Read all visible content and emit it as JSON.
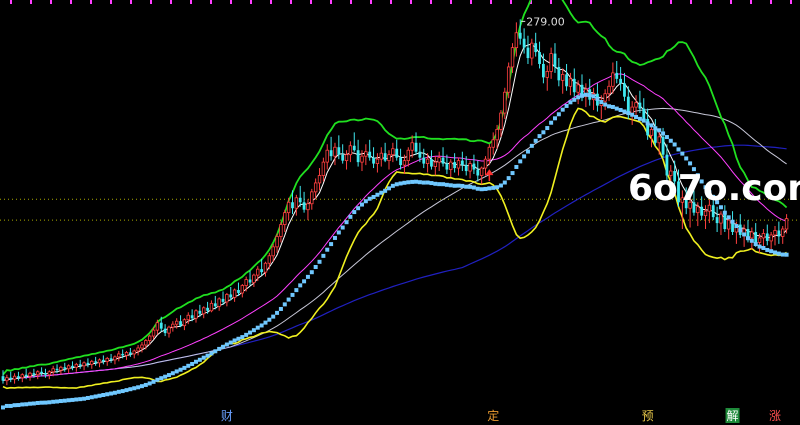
{
  "chart_data": {
    "type": "candlestick",
    "price_label": "279.00",
    "watermark": "6o7o.com",
    "event_markers": [
      {
        "label": "财",
        "bar": 58,
        "color": "#6aa0ff"
      },
      {
        "label": "定",
        "bar": 127,
        "color": "#e89a30"
      },
      {
        "label": "预",
        "bar": 167,
        "color": "#e8c84a"
      },
      {
        "label": "解",
        "bar": 189,
        "color": "#ffffff",
        "bg": "#1e8a3a"
      },
      {
        "label": "涨",
        "bar": 200,
        "color": "#ff5050"
      }
    ],
    "colors": {
      "up": "#ff4040",
      "down": "#40e8f0",
      "ma_white": "#ffffff",
      "ma_magenta": "#ff40ff",
      "ma_gray": "#c8c8d8",
      "ma_blue": "#2020c0",
      "dots": "#70c8ff",
      "band_upper": "#20e020",
      "band_lower": "#f0f020",
      "ref_line": "#a8a800",
      "top_ticks": "#ff40ff"
    },
    "x_index_range": [
      0,
      203
    ],
    "price_range": [
      25,
      290
    ],
    "reference_levels": [
      160,
      146
    ],
    "signal_arrow_bar": 126,
    "max_bar": 134,
    "candles": [
      [
        0,
        41,
        45,
        36,
        38
      ],
      [
        1,
        38,
        42,
        35,
        40
      ],
      [
        2,
        40,
        44,
        37,
        39
      ],
      [
        3,
        39,
        43,
        36,
        41
      ],
      [
        4,
        41,
        44,
        38,
        40
      ],
      [
        5,
        40,
        43,
        37,
        42
      ],
      [
        6,
        42,
        46,
        39,
        41
      ],
      [
        7,
        41,
        44,
        38,
        43
      ],
      [
        8,
        43,
        46,
        40,
        42
      ],
      [
        9,
        42,
        45,
        39,
        44
      ],
      [
        10,
        44,
        47,
        41,
        43
      ],
      [
        11,
        43,
        46,
        40,
        42
      ],
      [
        12,
        42,
        45,
        39,
        44
      ],
      [
        13,
        44,
        48,
        41,
        46
      ],
      [
        14,
        46,
        49,
        43,
        45
      ],
      [
        15,
        45,
        48,
        42,
        47
      ],
      [
        16,
        47,
        50,
        44,
        46
      ],
      [
        17,
        46,
        49,
        43,
        48
      ],
      [
        18,
        48,
        51,
        45,
        47
      ],
      [
        19,
        47,
        50,
        44,
        49
      ],
      [
        20,
        49,
        52,
        46,
        48
      ],
      [
        21,
        48,
        51,
        45,
        50
      ],
      [
        22,
        50,
        53,
        47,
        49
      ],
      [
        23,
        49,
        52,
        46,
        51
      ],
      [
        24,
        51,
        54,
        48,
        50
      ],
      [
        25,
        50,
        53,
        47,
        52
      ],
      [
        26,
        52,
        55,
        49,
        51
      ],
      [
        27,
        51,
        54,
        48,
        53
      ],
      [
        28,
        53,
        56,
        50,
        52
      ],
      [
        29,
        52,
        55,
        49,
        54
      ],
      [
        30,
        54,
        58,
        51,
        56
      ],
      [
        31,
        56,
        59,
        53,
        55
      ],
      [
        32,
        55,
        58,
        52,
        57
      ],
      [
        33,
        57,
        60,
        54,
        56
      ],
      [
        34,
        56,
        59,
        53,
        58
      ],
      [
        35,
        58,
        62,
        55,
        60
      ],
      [
        36,
        60,
        64,
        57,
        62
      ],
      [
        37,
        62,
        66,
        59,
        65
      ],
      [
        38,
        65,
        69,
        62,
        68
      ],
      [
        39,
        68,
        74,
        66,
        72
      ],
      [
        40,
        72,
        79,
        69,
        77
      ],
      [
        41,
        77,
        81,
        71,
        73
      ],
      [
        42,
        73,
        76,
        68,
        70
      ],
      [
        43,
        70,
        75,
        67,
        74
      ],
      [
        44,
        74,
        78,
        71,
        76
      ],
      [
        45,
        76,
        80,
        73,
        78
      ],
      [
        46,
        78,
        82,
        74,
        75
      ],
      [
        47,
        75,
        80,
        72,
        79
      ],
      [
        48,
        79,
        84,
        76,
        82
      ],
      [
        49,
        82,
        86,
        78,
        80
      ],
      [
        50,
        80,
        86,
        77,
        85
      ],
      [
        51,
        85,
        89,
        81,
        83
      ],
      [
        52,
        83,
        88,
        80,
        87
      ],
      [
        53,
        87,
        91,
        83,
        85
      ],
      [
        54,
        85,
        92,
        84,
        90
      ],
      [
        55,
        90,
        95,
        86,
        88
      ],
      [
        56,
        88,
        94,
        85,
        93
      ],
      [
        57,
        93,
        98,
        89,
        91
      ],
      [
        58,
        91,
        97,
        88,
        96
      ],
      [
        59,
        96,
        101,
        92,
        94
      ],
      [
        60,
        94,
        100,
        91,
        99
      ],
      [
        61,
        99,
        104,
        95,
        97
      ],
      [
        62,
        97,
        103,
        94,
        102
      ],
      [
        63,
        102,
        108,
        98,
        106
      ],
      [
        64,
        106,
        112,
        102,
        104
      ],
      [
        65,
        104,
        110,
        101,
        109
      ],
      [
        66,
        109,
        115,
        105,
        113
      ],
      [
        67,
        113,
        120,
        109,
        111
      ],
      [
        68,
        111,
        118,
        108,
        117
      ],
      [
        69,
        117,
        124,
        113,
        122
      ],
      [
        70,
        122,
        130,
        118,
        128
      ],
      [
        71,
        128,
        137,
        124,
        135
      ],
      [
        72,
        135,
        145,
        131,
        143
      ],
      [
        73,
        143,
        153,
        138,
        151
      ],
      [
        74,
        151,
        161,
        146,
        158
      ],
      [
        75,
        158,
        166,
        150,
        154
      ],
      [
        76,
        154,
        163,
        149,
        161
      ],
      [
        77,
        161,
        169,
        155,
        158
      ],
      [
        78,
        158,
        165,
        151,
        153
      ],
      [
        79,
        153,
        160,
        146,
        157
      ],
      [
        80,
        157,
        167,
        153,
        165
      ],
      [
        81,
        165,
        174,
        160,
        171
      ],
      [
        82,
        171,
        181,
        166,
        176
      ],
      [
        83,
        176,
        188,
        172,
        185
      ],
      [
        84,
        185,
        197,
        180,
        193
      ],
      [
        85,
        193,
        202,
        186,
        189
      ],
      [
        86,
        189,
        198,
        183,
        195
      ],
      [
        87,
        195,
        203,
        187,
        190
      ],
      [
        88,
        190,
        197,
        184,
        186
      ],
      [
        89,
        186,
        193,
        180,
        190
      ],
      [
        90,
        190,
        199,
        185,
        196
      ],
      [
        91,
        196,
        205,
        192,
        193
      ],
      [
        92,
        193,
        200,
        182,
        185
      ],
      [
        93,
        185,
        193,
        179,
        189
      ],
      [
        94,
        189,
        197,
        183,
        192
      ],
      [
        95,
        192,
        200,
        186,
        188
      ],
      [
        96,
        188,
        195,
        181,
        184
      ],
      [
        97,
        184,
        191,
        178,
        187
      ],
      [
        98,
        187,
        195,
        182,
        191
      ],
      [
        99,
        191,
        198,
        185,
        186
      ],
      [
        100,
        186,
        193,
        180,
        190
      ],
      [
        101,
        190,
        198,
        185,
        194
      ],
      [
        102,
        194,
        200,
        186,
        188
      ],
      [
        103,
        188,
        194,
        180,
        183
      ],
      [
        104,
        183,
        190,
        177,
        186
      ],
      [
        105,
        186,
        195,
        182,
        193
      ],
      [
        106,
        193,
        203,
        188,
        198
      ],
      [
        107,
        198,
        205,
        190,
        192
      ],
      [
        108,
        192,
        198,
        185,
        188
      ],
      [
        109,
        188,
        194,
        181,
        184
      ],
      [
        110,
        184,
        191,
        178,
        187
      ],
      [
        111,
        187,
        193,
        180,
        182
      ],
      [
        112,
        182,
        189,
        176,
        185
      ],
      [
        113,
        185,
        192,
        179,
        188
      ],
      [
        114,
        188,
        195,
        182,
        184
      ],
      [
        115,
        184,
        190,
        177,
        180
      ],
      [
        116,
        180,
        187,
        175,
        185
      ],
      [
        117,
        185,
        191,
        178,
        181
      ],
      [
        118,
        181,
        188,
        176,
        186
      ],
      [
        119,
        186,
        192,
        179,
        183
      ],
      [
        120,
        183,
        189,
        176,
        179
      ],
      [
        121,
        179,
        186,
        174,
        184
      ],
      [
        122,
        184,
        190,
        177,
        180
      ],
      [
        123,
        180,
        186,
        172,
        176
      ],
      [
        124,
        176,
        182,
        170,
        181
      ],
      [
        125,
        181,
        189,
        176,
        187
      ],
      [
        126,
        187,
        197,
        183,
        195
      ],
      [
        127,
        195,
        205,
        190,
        200
      ],
      [
        128,
        200,
        210,
        194,
        207
      ],
      [
        129,
        207,
        220,
        202,
        218
      ],
      [
        130,
        218,
        235,
        214,
        232
      ],
      [
        131,
        232,
        252,
        228,
        249
      ],
      [
        132,
        249,
        265,
        245,
        262
      ],
      [
        133,
        262,
        279,
        256,
        272
      ],
      [
        134,
        272,
        281,
        264,
        268
      ],
      [
        135,
        268,
        275,
        258,
        262
      ],
      [
        136,
        262,
        270,
        251,
        255
      ],
      [
        137,
        255,
        268,
        250,
        265
      ],
      [
        138,
        265,
        272,
        256,
        259
      ],
      [
        139,
        259,
        266,
        248,
        251
      ],
      [
        140,
        251,
        258,
        238,
        242
      ],
      [
        141,
        242,
        250,
        233,
        246
      ],
      [
        142,
        246,
        262,
        241,
        258
      ],
      [
        143,
        258,
        265,
        245,
        249
      ],
      [
        144,
        249,
        255,
        236,
        240
      ],
      [
        145,
        240,
        248,
        231,
        244
      ],
      [
        146,
        244,
        251,
        233,
        236
      ],
      [
        147,
        236,
        245,
        230,
        241
      ],
      [
        148,
        241,
        248,
        229,
        232
      ],
      [
        149,
        232,
        240,
        224,
        237
      ],
      [
        150,
        237,
        244,
        226,
        229
      ],
      [
        151,
        229,
        238,
        222,
        234
      ],
      [
        152,
        234,
        241,
        223,
        227
      ],
      [
        153,
        227,
        235,
        220,
        231
      ],
      [
        154,
        231,
        238,
        219,
        223
      ],
      [
        155,
        223,
        230,
        214,
        226
      ],
      [
        156,
        226,
        234,
        220,
        231
      ],
      [
        157,
        231,
        240,
        226,
        236
      ],
      [
        158,
        236,
        252,
        231,
        245
      ],
      [
        159,
        245,
        253,
        238,
        241
      ],
      [
        160,
        241,
        249,
        233,
        238
      ],
      [
        161,
        238,
        245,
        226,
        229
      ],
      [
        162,
        229,
        236,
        214,
        218
      ],
      [
        163,
        218,
        226,
        210,
        222
      ],
      [
        164,
        222,
        230,
        215,
        225
      ],
      [
        165,
        225,
        233,
        218,
        221
      ],
      [
        166,
        221,
        228,
        212,
        214
      ],
      [
        167,
        214,
        221,
        200,
        203
      ],
      [
        168,
        203,
        211,
        195,
        207
      ],
      [
        169,
        207,
        214,
        196,
        198
      ],
      [
        170,
        198,
        206,
        190,
        202
      ],
      [
        171,
        202,
        208,
        188,
        190
      ],
      [
        172,
        190,
        197,
        172,
        176
      ],
      [
        173,
        176,
        183,
        166,
        179
      ],
      [
        174,
        179,
        186,
        170,
        172
      ],
      [
        175,
        172,
        180,
        155,
        158
      ],
      [
        176,
        158,
        166,
        140,
        161
      ],
      [
        177,
        161,
        168,
        150,
        154
      ],
      [
        178,
        154,
        162,
        141,
        158
      ],
      [
        179,
        158,
        166,
        149,
        151
      ],
      [
        180,
        151,
        158,
        142,
        155
      ],
      [
        181,
        155,
        162,
        146,
        149
      ],
      [
        182,
        149,
        156,
        140,
        152
      ],
      [
        183,
        152,
        160,
        144,
        156
      ],
      [
        184,
        156,
        163,
        146,
        148
      ],
      [
        185,
        148,
        155,
        138,
        144
      ],
      [
        186,
        144,
        152,
        136,
        150
      ],
      [
        187,
        150,
        156,
        138,
        140
      ],
      [
        188,
        140,
        148,
        133,
        146
      ],
      [
        189,
        146,
        152,
        136,
        138
      ],
      [
        190,
        138,
        145,
        130,
        143
      ],
      [
        191,
        143,
        150,
        134,
        136
      ],
      [
        192,
        136,
        143,
        128,
        140
      ],
      [
        193,
        140,
        146,
        131,
        134
      ],
      [
        194,
        134,
        141,
        126,
        138
      ],
      [
        195,
        138,
        144,
        128,
        131
      ],
      [
        196,
        131,
        137,
        124,
        134
      ],
      [
        197,
        134,
        140,
        127,
        137
      ],
      [
        198,
        137,
        143,
        129,
        132
      ],
      [
        199,
        132,
        138,
        126,
        136
      ],
      [
        200,
        136,
        142,
        129,
        139
      ],
      [
        201,
        139,
        145,
        130,
        135
      ],
      [
        202,
        135,
        142,
        130,
        140
      ],
      [
        203,
        140,
        150,
        137,
        147
      ]
    ]
  }
}
